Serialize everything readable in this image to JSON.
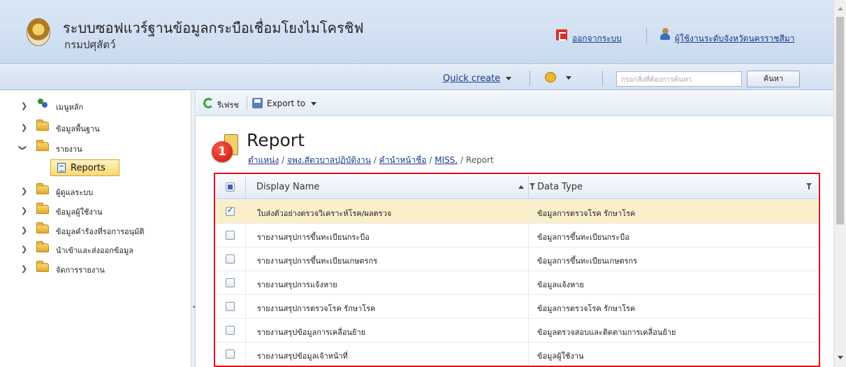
{
  "header": {
    "app_title": "ระบบซอฟแวร์ฐานข้อมูลกระบือเชื่อมโยงไมโครชิฟ",
    "app_subtitle": "กรมปศุสัตว์",
    "logout_label": "ออกจากระบบ",
    "user_label": "ผู้ใช้งานระดับจังหวัดนครราชสีมา"
  },
  "topbar": {
    "quick_create_label": "Quick create",
    "search_placeholder": "กรอกสิ่งที่ต้องการค้นหา",
    "search_button_label": "ค้นหา"
  },
  "sidebar": {
    "items": [
      {
        "label": "เมนูหลัก",
        "icon": "home-icon"
      },
      {
        "label": "ข้อมูลพื้นฐาน",
        "icon": "folder-icon"
      },
      {
        "label": "รายงาน",
        "icon": "folder-icon",
        "expanded": true
      },
      {
        "label": "ผู้ดูแลระบบ",
        "icon": "folder-icon"
      },
      {
        "label": "ข้อมูลผู้ใช้งาน",
        "icon": "folder-icon"
      },
      {
        "label": "ข้อมูลคำร้องที่รอการอนุมัติ",
        "icon": "folder-icon"
      },
      {
        "label": "นำเข้าและส่งออกข้อมูล",
        "icon": "folder-icon"
      },
      {
        "label": "จัดการรายงาน",
        "icon": "folder-icon"
      }
    ],
    "selected_child": "Reports"
  },
  "toolbar": {
    "refresh_label": "รีเฟรช",
    "export_label": "Export to"
  },
  "main": {
    "badge_number": "1",
    "title": "Report",
    "breadcrumb": [
      "ตำแหน่ง",
      "จพง.สัตวบาลปฏิบัติงาน",
      "คำนำหน้าชื่อ",
      "MISS.",
      "Report"
    ],
    "grid": {
      "columns": [
        "Display Name",
        "Data Type"
      ],
      "rows": [
        {
          "checked": true,
          "display_name": "ใบส่งตัวอย่างตรวจวิเคราะห์โรค/ผลตรวจ",
          "data_type": "ข้อมูลการตรวจโรค รักษาโรค"
        },
        {
          "checked": false,
          "display_name": "รายงานสรุปการขึ้นทะเบียนกระบือ",
          "data_type": "ข้อมูลการขึ้นทะเบียนกระบือ"
        },
        {
          "checked": false,
          "display_name": "รายงานสรุปการขึ้นทะเบียนเกษตรกร",
          "data_type": "ข้อมูลการขึ้นทะเบียนเกษตรกร"
        },
        {
          "checked": false,
          "display_name": "รายงานสรุปการแจ้งหาย",
          "data_type": "ข้อมูลแจ้งหาย"
        },
        {
          "checked": false,
          "display_name": "รายงานสรุปการตรวจโรค รักษาโรค",
          "data_type": "ข้อมูลการตรวจโรค รักษาโรค"
        },
        {
          "checked": false,
          "display_name": "รายงานสรุปข้อมูลการเคลื่อนย้าย",
          "data_type": "ข้อมูลตรวจสอบและติดตามการเคลื่อนย้าย"
        },
        {
          "checked": false,
          "display_name": "รายงานสรุปข้อมูลเจ้าหน้าที่",
          "data_type": "ข้อมูลผู้ใช้งาน"
        }
      ]
    }
  },
  "colors": {
    "highlight_border": "#e0111a",
    "selected_row": "#fbefc9",
    "link": "#1a3a8a"
  }
}
